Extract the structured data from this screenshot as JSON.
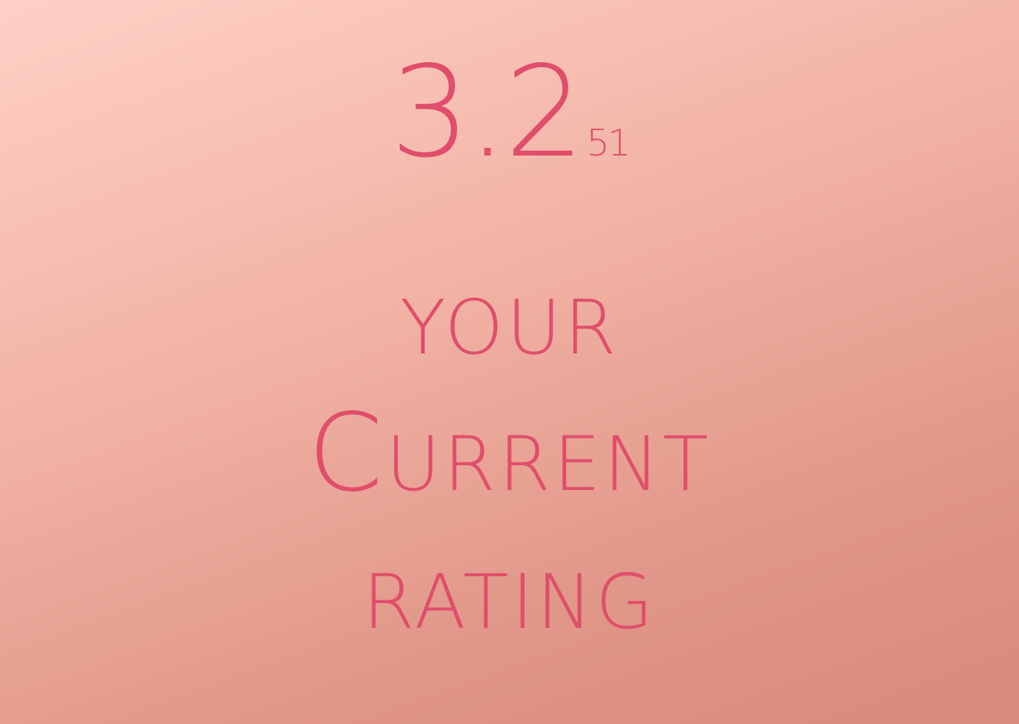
{
  "rating": {
    "value": "3.2",
    "count": "51"
  },
  "caption": {
    "line1": "Your",
    "line2": "Current",
    "line3": "Rating"
  },
  "colors": {
    "accent": "#e04e6c",
    "background_top": "#ffd0c6",
    "background_bottom": "#d88a7c"
  }
}
